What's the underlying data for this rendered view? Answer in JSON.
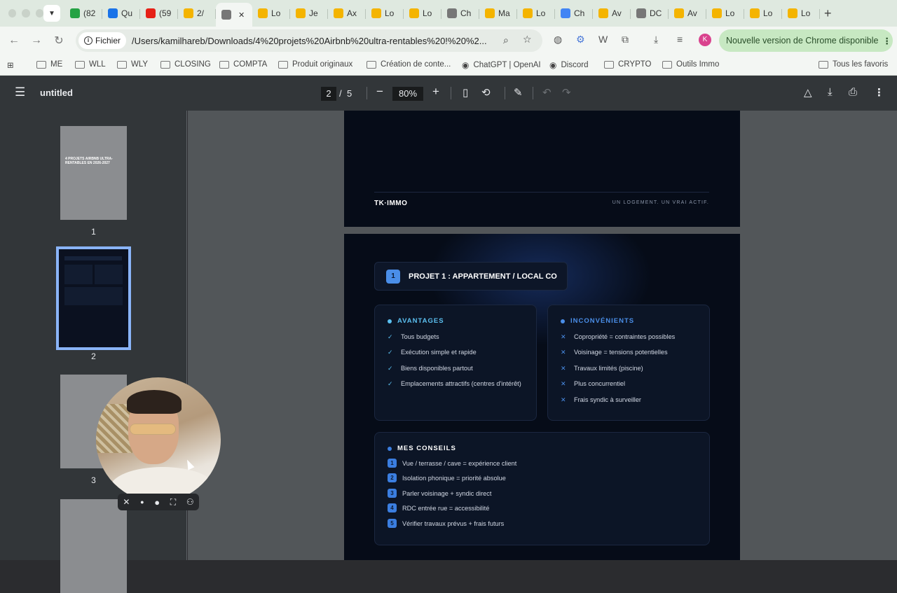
{
  "browser": {
    "tabs": [
      {
        "label": "(82",
        "color": "#25a244",
        "icon": "whatsapp-icon"
      },
      {
        "label": "Qu",
        "color": "#1a73e8",
        "icon": "settings-app-icon"
      },
      {
        "label": "(59",
        "color": "#e62117",
        "icon": "youtube-icon"
      },
      {
        "label": "2/",
        "color": "#f4b400",
        "icon": "google-drive-icon"
      },
      {
        "label": "",
        "color": "#777777",
        "icon": "globe-icon",
        "active": true
      },
      {
        "label": "Lo",
        "color": "#f4b400",
        "icon": "google-drive-icon"
      },
      {
        "label": "Je",
        "color": "#f4b400",
        "icon": "google-drive-icon"
      },
      {
        "label": "Ax",
        "color": "#f4b400",
        "icon": "google-drive-icon"
      },
      {
        "label": "Lo",
        "color": "#f4b400",
        "icon": "google-drive-icon"
      },
      {
        "label": "Lo",
        "color": "#f4b400",
        "icon": "google-drive-icon"
      },
      {
        "label": "Ch",
        "color": "#777777",
        "icon": "globe-icon"
      },
      {
        "label": "Ma",
        "color": "#f4b400",
        "icon": "google-drive-icon"
      },
      {
        "label": "Lo",
        "color": "#f4b400",
        "icon": "google-drive-icon"
      },
      {
        "label": "Ch",
        "color": "#4285f4",
        "icon": "google-docs-icon"
      },
      {
        "label": "Av",
        "color": "#f4b400",
        "icon": "google-drive-icon"
      },
      {
        "label": "DC",
        "color": "#777777",
        "icon": "globe-icon"
      },
      {
        "label": "Av",
        "color": "#f4b400",
        "icon": "google-drive-icon"
      },
      {
        "label": "Lo",
        "color": "#f4b400",
        "icon": "google-drive-icon"
      },
      {
        "label": "Lo",
        "color": "#f4b400",
        "icon": "google-drive-icon"
      },
      {
        "label": "Lo",
        "color": "#f4b400",
        "icon": "google-drive-icon"
      }
    ],
    "omnibox": {
      "chip_label": "Fichier",
      "url": "/Users/kamilhareb/Downloads/4%20projets%20Airbnb%20ultra-rentables%20!%20%2..."
    },
    "update_label": "Nouvelle version de Chrome disponible",
    "profile_initial": "K",
    "bookmarks": [
      {
        "label": "ME",
        "icon": "folder-icon"
      },
      {
        "label": "WLL",
        "icon": "folder-icon"
      },
      {
        "label": "WLY",
        "icon": "folder-icon"
      },
      {
        "label": "CLOSING",
        "icon": "folder-icon"
      },
      {
        "label": "COMPTA",
        "icon": "folder-icon"
      },
      {
        "label": "Produit originaux",
        "icon": "folder-icon"
      },
      {
        "label": "Création de conte...",
        "icon": "folder-icon"
      },
      {
        "label": "ChatGPT | OpenAI",
        "icon": "openai-icon"
      },
      {
        "label": "Discord",
        "icon": "globe-icon"
      },
      {
        "label": "CRYPTO",
        "icon": "folder-icon"
      },
      {
        "label": "Outils Immo",
        "icon": "folder-icon"
      }
    ],
    "all_bookmarks_label": "Tous les favoris"
  },
  "pdf": {
    "title": "untitled",
    "current_page": "2",
    "page_sep": "/",
    "total_pages": "5",
    "zoom": "80%",
    "thumbnails": [
      {
        "num": "1",
        "title_text": "4 PROJETS AIRBNB ULTRA-RENTABLES EN 2026-2027"
      },
      {
        "num": "2"
      },
      {
        "num": "3"
      },
      {
        "num": ""
      }
    ]
  },
  "document": {
    "brand": "TK·IMMO",
    "slogan": "UN LOGEMENT. UN VRAI ACTIF.",
    "project": {
      "number": "1",
      "title": "PROJET 1 : APPARTEMENT / LOCAL CO"
    },
    "advantages": {
      "heading": "AVANTAGES",
      "color": "#5bc0f0",
      "items": [
        "Tous budgets",
        "Exécution simple et rapide",
        "Biens disponibles partout",
        "Emplacements attractifs (centres d'intérêt)"
      ]
    },
    "disadvantages": {
      "heading": "INCONVÉNIENTS",
      "color": "#4a8ee8",
      "items": [
        "Copropriété = contraintes possibles",
        "Voisinage = tensions potentielles",
        "Travaux limités (piscine)",
        "Plus concurrentiel",
        "Frais syndic à surveiller"
      ]
    },
    "tips": {
      "heading": "MES CONSEILS",
      "items": [
        {
          "n": "1",
          "text": "Vue / terrasse / cave = expérience client"
        },
        {
          "n": "2",
          "text": "Isolation phonique = priorité absolue"
        },
        {
          "n": "3",
          "text": "Parler voisinage + syndic direct"
        },
        {
          "n": "4",
          "text": "RDC entrée rue = accessibilité"
        },
        {
          "n": "5",
          "text": "Vérifier travaux prévus + frais futurs"
        }
      ]
    }
  }
}
